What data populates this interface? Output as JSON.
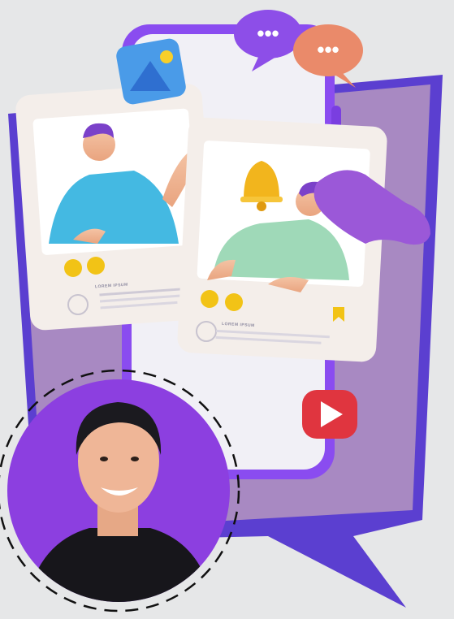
{
  "post_cards": [
    {
      "heading": "LOREM IPSUM"
    },
    {
      "heading": "LOREM IPSUM"
    }
  ],
  "chat_bubbles": [
    {
      "text": "•••"
    },
    {
      "text": "•••"
    }
  ],
  "colors": {
    "background": "#e6e7e8",
    "speech_frame": "#5b3fd0",
    "speech_fill": "#a889c2",
    "phone": "#8a4cf0",
    "avatar_bg": "#8c3fe0",
    "play_button": "#e0353f"
  },
  "icons": [
    "image-icon",
    "bell-icon",
    "heart-icon",
    "bookmark-icon",
    "play-icon",
    "chat-bubble-icon"
  ]
}
